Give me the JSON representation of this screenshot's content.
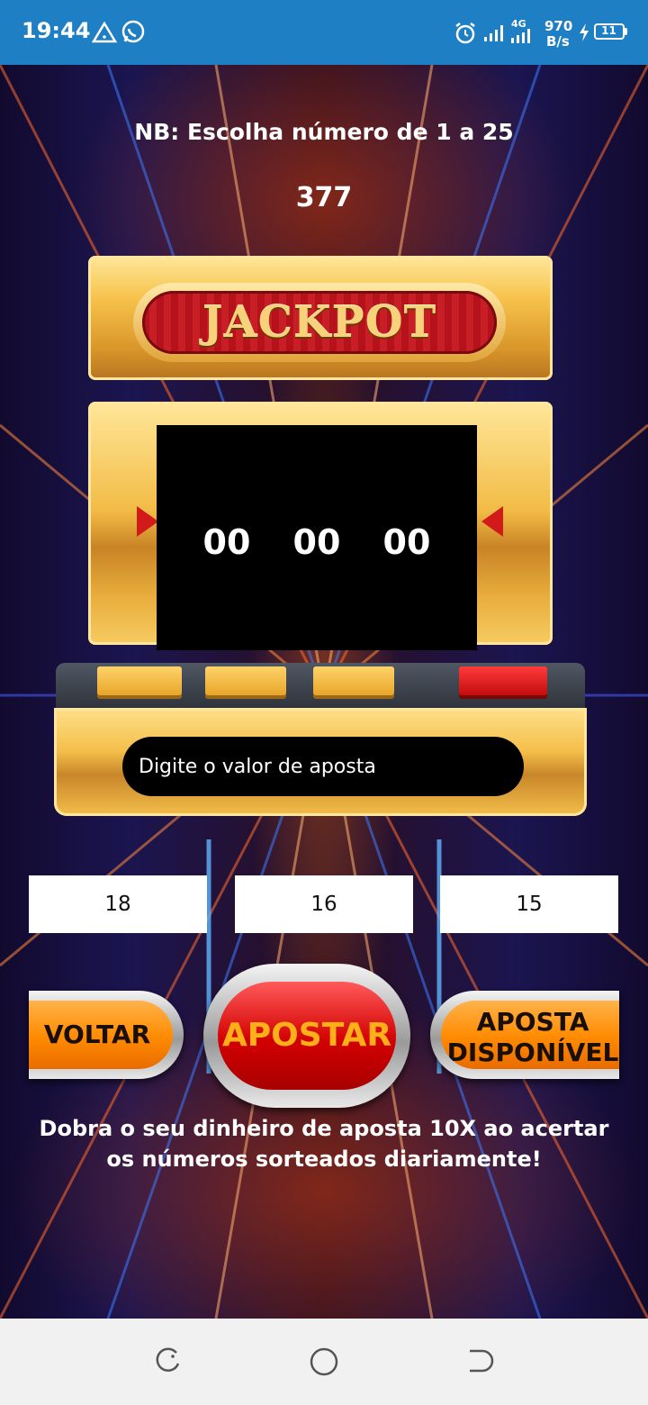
{
  "status_bar": {
    "time": "19:44",
    "network_type": "4G",
    "speed_value": "970",
    "speed_unit": "B/s",
    "battery": "11",
    "icons": [
      "alert-triangle-icon",
      "whatsapp-icon",
      "alarm-icon",
      "signal-icon",
      "signal-4g-icon",
      "charging-icon",
      "battery-icon"
    ]
  },
  "header": {
    "instruction": "NB: Escolha número de 1 a 25",
    "balance": "377"
  },
  "machine": {
    "title": "JACKPOT",
    "reels": [
      "00",
      "00",
      "00"
    ],
    "bet_placeholder": "Digite o valor de aposta"
  },
  "numbers": [
    "18",
    "16",
    "15"
  ],
  "buttons": {
    "back": "VOLTAR",
    "bet": "APOSTAR",
    "available_line1": "APOSTA",
    "available_line2": "DISPONÍVEL"
  },
  "footer": {
    "message": "Dobra o seu dinheiro de aposta 10X ao acertar os números sorteados diariamente!"
  },
  "nav_bar": {
    "icons": [
      "recent-apps-icon",
      "home-icon",
      "back-icon"
    ]
  },
  "colors": {
    "status_bar": "#1f7fc4",
    "button_orange": "#ff8a00",
    "button_red": "#d20000",
    "apostar_text": "#ffb019",
    "gold": "#f2bb45"
  }
}
